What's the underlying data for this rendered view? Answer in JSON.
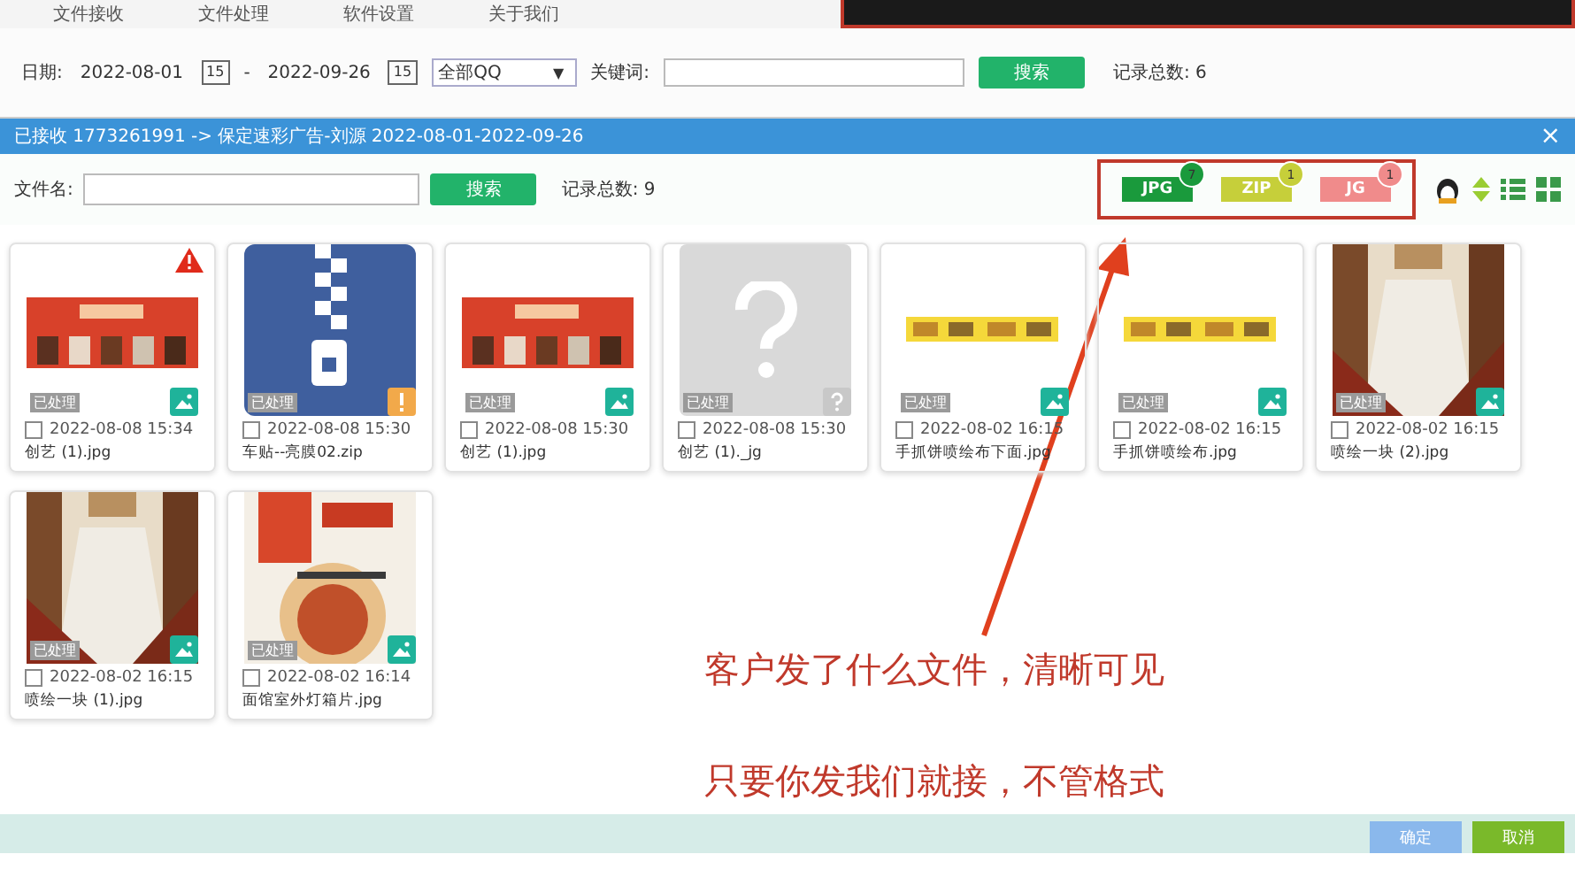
{
  "menu": [
    "文件接收",
    "文件处理",
    "软件设置",
    "关于我们"
  ],
  "filter": {
    "date_label": "日期:",
    "start": "2022-08-01",
    "sep": "-",
    "end": "2022-09-26",
    "calendar_start": "15",
    "calendar_end": "15",
    "account": "全部QQ",
    "caret": "▼",
    "keyword_label": "关键词:",
    "search": "搜索",
    "total": "记录总数: 6"
  },
  "dialog": {
    "title": "已接收 1773261991 -> 保定速彩广告-刘源 2022-08-01-2022-09-26",
    "close": "×",
    "file_label": "文件名:",
    "search": "搜索",
    "total": "记录总数: 9",
    "types": [
      {
        "label": "JPG",
        "count": "7",
        "color": "#1a9a3c"
      },
      {
        "label": "ZIP",
        "count": "1",
        "color": "#c6cf3a"
      },
      {
        "label": "JG",
        "count": "1",
        "color": "#f08b8b"
      }
    ],
    "files": [
      {
        "kind": "banner",
        "warning": true,
        "status": "已处理",
        "checked": false,
        "time": "2022-08-08 15:34",
        "name": "创艺 (1).jpg"
      },
      {
        "kind": "zip",
        "warning": false,
        "status": "已处理",
        "checked": false,
        "time": "2022-08-08 15:30",
        "name": "车贴--亮膜02.zip"
      },
      {
        "kind": "banner",
        "warning": false,
        "status": "已处理",
        "checked": false,
        "time": "2022-08-08 15:30",
        "name": "创艺 (1).jpg"
      },
      {
        "kind": "unknown",
        "warning": false,
        "status": "已处理",
        "checked": false,
        "time": "2022-08-08 15:30",
        "name": "创艺 (1)._jg"
      },
      {
        "kind": "strip",
        "warning": false,
        "status": "已处理",
        "checked": false,
        "time": "2022-08-02 16:15",
        "name": "手抓饼喷绘布下面.jpg"
      },
      {
        "kind": "strip",
        "warning": false,
        "status": "已处理",
        "checked": false,
        "time": "2022-08-02 16:15",
        "name": "手抓饼喷绘布.jpg"
      },
      {
        "warning": false,
        "status": "已处理",
        "checked": false,
        "time": "2022-08-02 16:15",
        "name": "喷绘一块 (2).jpg"
      },
      {
        "warning": false,
        "status": "已处理",
        "checked": false,
        "time": "2022-08-02 16:15",
        "name": "喷绘一块 (1).jpg"
      },
      {
        "kind": "food",
        "warning": false,
        "status": "已处理",
        "checked": false,
        "time": "2022-08-02 16:14",
        "name": "面馆室外灯箱片.jpg"
      }
    ],
    "ok": "确定",
    "cancel": "取消"
  },
  "notes": [
    "客户发了什么文件，清晰可见",
    "只要你发我们就接，不管格式"
  ]
}
